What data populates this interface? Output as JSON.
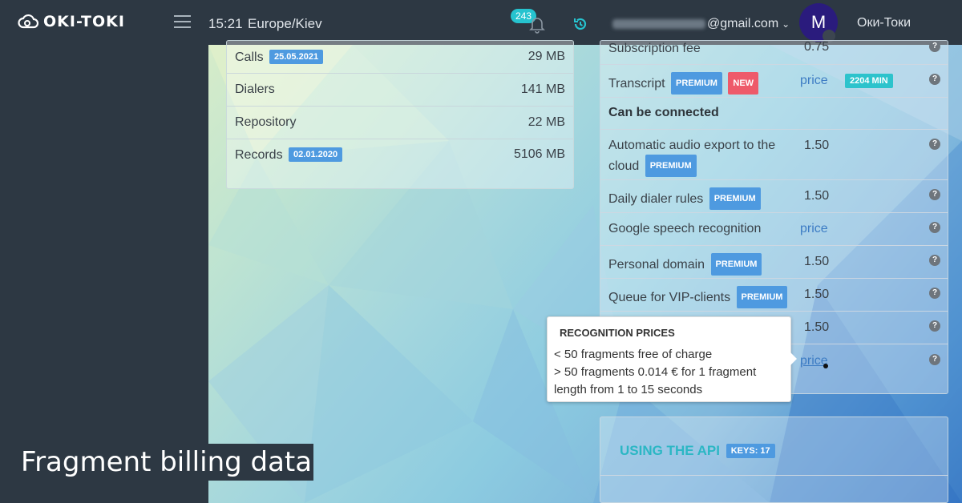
{
  "header": {
    "logo_text": "OKI-TOKI",
    "time": "15:21",
    "timezone": "Europe/Kiev",
    "notifications_count": "243",
    "email_suffix": "@gmail.com",
    "avatar_letter": "M",
    "username": "Оки-Токи"
  },
  "storage": {
    "rows": [
      {
        "label": "Calls",
        "badge": "25.05.2021",
        "value": "29 MB"
      },
      {
        "label": "Dialers",
        "badge": "",
        "value": "141 MB"
      },
      {
        "label": "Repository",
        "badge": "",
        "value": "22 MB"
      },
      {
        "label": "Records",
        "badge": "02.01.2020",
        "value": "5106 MB"
      }
    ]
  },
  "services": {
    "subscription_label": "Subscription fee",
    "subscription_value": "0.75",
    "transcript_label": "Transcript",
    "premium_badge": "PREMIUM",
    "new_badge": "NEW",
    "price_link": "price",
    "minutes_badge": "2204 MIN",
    "section_connected": "Can be connected",
    "audio_export_line1": "Automatic audio export to the",
    "audio_export_line2": "cloud",
    "audio_export_value": "1.50",
    "daily_rules_label": "Daily dialer rules",
    "daily_rules_value": "1.50",
    "google_speech_label": "Google speech recognition",
    "google_speech_value": "price",
    "personal_domain_label": "Personal domain",
    "personal_domain_value": "1.50",
    "vip_queue_label": "Queue for VIP-clients",
    "vip_queue_value": "1.50",
    "hidden_row_value": "1.50",
    "last_row_value": "price",
    "help_glyph": "?"
  },
  "tooltip": {
    "title": "RECOGNITION PRICES",
    "line1": "< 50 fragments free of charge",
    "line2": "> 50 fragments 0.014 € for 1 fragment",
    "line3": "length from 1 to 15 seconds"
  },
  "api": {
    "title": "USING THE API",
    "keys_badge": "KEYS: 17"
  },
  "caption": "Fragment billing data",
  "colors": {
    "topbar": "#2d3843",
    "accent_cyan": "#26c3cf",
    "badge_blue": "#4e9ae0",
    "badge_red": "#ee5a6a",
    "avatar": "#2a1b7d",
    "link": "#3d7cc4"
  }
}
